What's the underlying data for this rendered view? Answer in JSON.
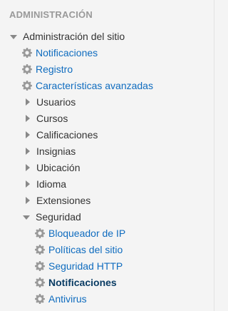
{
  "block": {
    "title": "ADMINISTRACIÓN"
  },
  "tree": {
    "root_label": "Administración del sitio",
    "items": [
      {
        "label": "Notificaciones",
        "icon": "gear-icon",
        "type": "link"
      },
      {
        "label": "Registro",
        "icon": "gear-icon",
        "type": "link"
      },
      {
        "label": "Características avanzadas",
        "icon": "gear-icon",
        "type": "link"
      },
      {
        "label": "Usuarios",
        "icon": "chevron-right-icon",
        "type": "branch"
      },
      {
        "label": "Cursos",
        "icon": "chevron-right-icon",
        "type": "branch"
      },
      {
        "label": "Calificaciones",
        "icon": "chevron-right-icon",
        "type": "branch"
      },
      {
        "label": "Insignias",
        "icon": "chevron-right-icon",
        "type": "branch"
      },
      {
        "label": "Ubicación",
        "icon": "chevron-right-icon",
        "type": "branch"
      },
      {
        "label": "Idioma",
        "icon": "chevron-right-icon",
        "type": "branch"
      },
      {
        "label": "Extensiones",
        "icon": "chevron-right-icon",
        "type": "branch"
      },
      {
        "label": "Seguridad",
        "icon": "chevron-down-icon",
        "type": "branch-open"
      }
    ],
    "security_items": [
      {
        "label": "Bloqueador de IP",
        "icon": "gear-icon"
      },
      {
        "label": "Políticas del sitio",
        "icon": "gear-icon"
      },
      {
        "label": "Seguridad HTTP",
        "icon": "gear-icon"
      },
      {
        "label": "Notificaciones",
        "icon": "gear-icon",
        "current": true
      },
      {
        "label": "Antivirus",
        "icon": "gear-icon"
      }
    ]
  },
  "colors": {
    "link": "#0f6cbf",
    "current_link": "#0a3c64",
    "text": "#333333",
    "header": "#999999",
    "gear": "#999999"
  }
}
